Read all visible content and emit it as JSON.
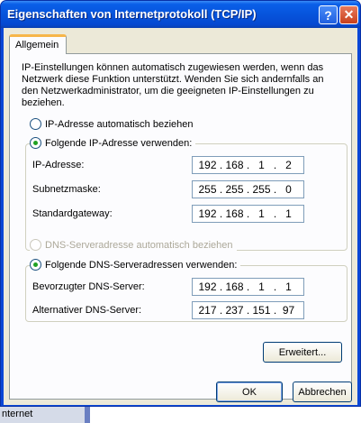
{
  "window": {
    "title": "Eigenschaften von Internetprotokoll (TCP/IP)",
    "help_glyph": "?",
    "close_glyph": "✕"
  },
  "tabs": [
    {
      "label": "Allgemein"
    }
  ],
  "description": "IP-Einstellungen können automatisch zugewiesen werden, wenn das Netzwerk diese Funktion unterstützt. Wenden Sie sich andernfalls an den Netzwerkadministrator, um die geeigneten IP-Einstellungen zu beziehen.",
  "ip": {
    "auto_label": "IP-Adresse automatisch beziehen",
    "manual_label": "Folgende IP-Adresse verwenden:",
    "fields": [
      {
        "label": "IP-Adresse:",
        "octets": [
          "192",
          "168",
          "1",
          "2"
        ]
      },
      {
        "label": "Subnetzmaske:",
        "octets": [
          "255",
          "255",
          "255",
          "0"
        ]
      },
      {
        "label": "Standardgateway:",
        "octets": [
          "192",
          "168",
          "1",
          "1"
        ]
      }
    ]
  },
  "dns": {
    "auto_label": "DNS-Serveradresse automatisch beziehen",
    "manual_label": "Folgende DNS-Serveradressen verwenden:",
    "fields": [
      {
        "label": "Bevorzugter DNS-Server:",
        "octets": [
          "192",
          "168",
          "1",
          "1"
        ]
      },
      {
        "label": "Alternativer DNS-Server:",
        "octets": [
          "217",
          "237",
          "151",
          "97"
        ]
      }
    ]
  },
  "buttons": {
    "advanced": "Erweitert...",
    "ok": "OK",
    "cancel": "Abbrechen"
  },
  "background": {
    "item_label": "nternet"
  }
}
